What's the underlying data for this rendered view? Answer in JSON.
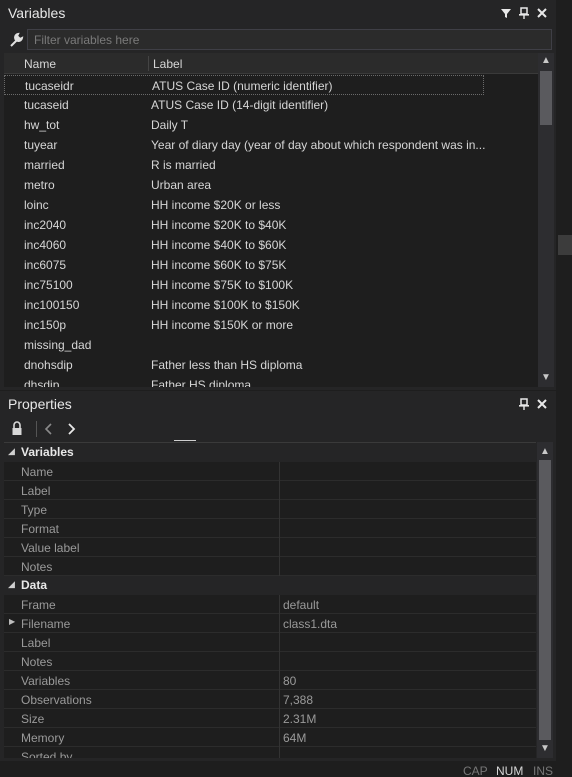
{
  "variables_panel": {
    "title": "Variables",
    "filter_placeholder": "Filter variables here",
    "columns": {
      "name": "Name",
      "label": "Label"
    },
    "rows": [
      {
        "name": "tucaseidr",
        "label": "ATUS Case ID (numeric identifier)"
      },
      {
        "name": "tucaseid",
        "label": "ATUS Case ID (14-digit identifier)"
      },
      {
        "name": "hw_tot",
        "label": "Daily T"
      },
      {
        "name": "tuyear",
        "label": "Year of diary day (year of day about which respondent was in..."
      },
      {
        "name": "married",
        "label": "R is married"
      },
      {
        "name": "metro",
        "label": "Urban area"
      },
      {
        "name": "loinc",
        "label": "HH income $20K or less"
      },
      {
        "name": "inc2040",
        "label": "HH income $20K to $40K"
      },
      {
        "name": "inc4060",
        "label": "HH income $40K to $60K"
      },
      {
        "name": "inc6075",
        "label": "HH income $60K to $75K"
      },
      {
        "name": "inc75100",
        "label": "HH income $75K to $100K"
      },
      {
        "name": "inc100150",
        "label": "HH income $100K to $150K"
      },
      {
        "name": "inc150p",
        "label": "HH income $150K or more"
      },
      {
        "name": "missing_dad",
        "label": ""
      },
      {
        "name": "dnohsdip",
        "label": "Father less than HS diploma"
      },
      {
        "name": "dhsdip",
        "label": "Father HS diploma"
      }
    ]
  },
  "properties_panel": {
    "title": "Properties",
    "groups": [
      {
        "label": "Variables",
        "items": [
          {
            "key": "Name",
            "value": ""
          },
          {
            "key": "Label",
            "value": ""
          },
          {
            "key": "Type",
            "value": ""
          },
          {
            "key": "Format",
            "value": ""
          },
          {
            "key": "Value label",
            "value": ""
          },
          {
            "key": "Notes",
            "value": ""
          }
        ]
      },
      {
        "label": "Data",
        "items": [
          {
            "key": "Frame",
            "value": "default"
          },
          {
            "key": "Filename",
            "value": "class1.dta"
          },
          {
            "key": "Label",
            "value": ""
          },
          {
            "key": "Notes",
            "value": ""
          },
          {
            "key": "Variables",
            "value": "80"
          },
          {
            "key": "Observations",
            "value": "7,388"
          },
          {
            "key": "Size",
            "value": "2.31M"
          },
          {
            "key": "Memory",
            "value": "64M"
          },
          {
            "key": "Sorted by",
            "value": ""
          }
        ]
      }
    ]
  },
  "statusbar": {
    "cap": "CAP",
    "num": "NUM",
    "ins": "INS"
  },
  "icons": [
    "filter-icon",
    "pin-icon",
    "close-icon",
    "wrench-icon",
    "lock-icon",
    "back-arrow-icon",
    "forward-arrow-icon"
  ]
}
